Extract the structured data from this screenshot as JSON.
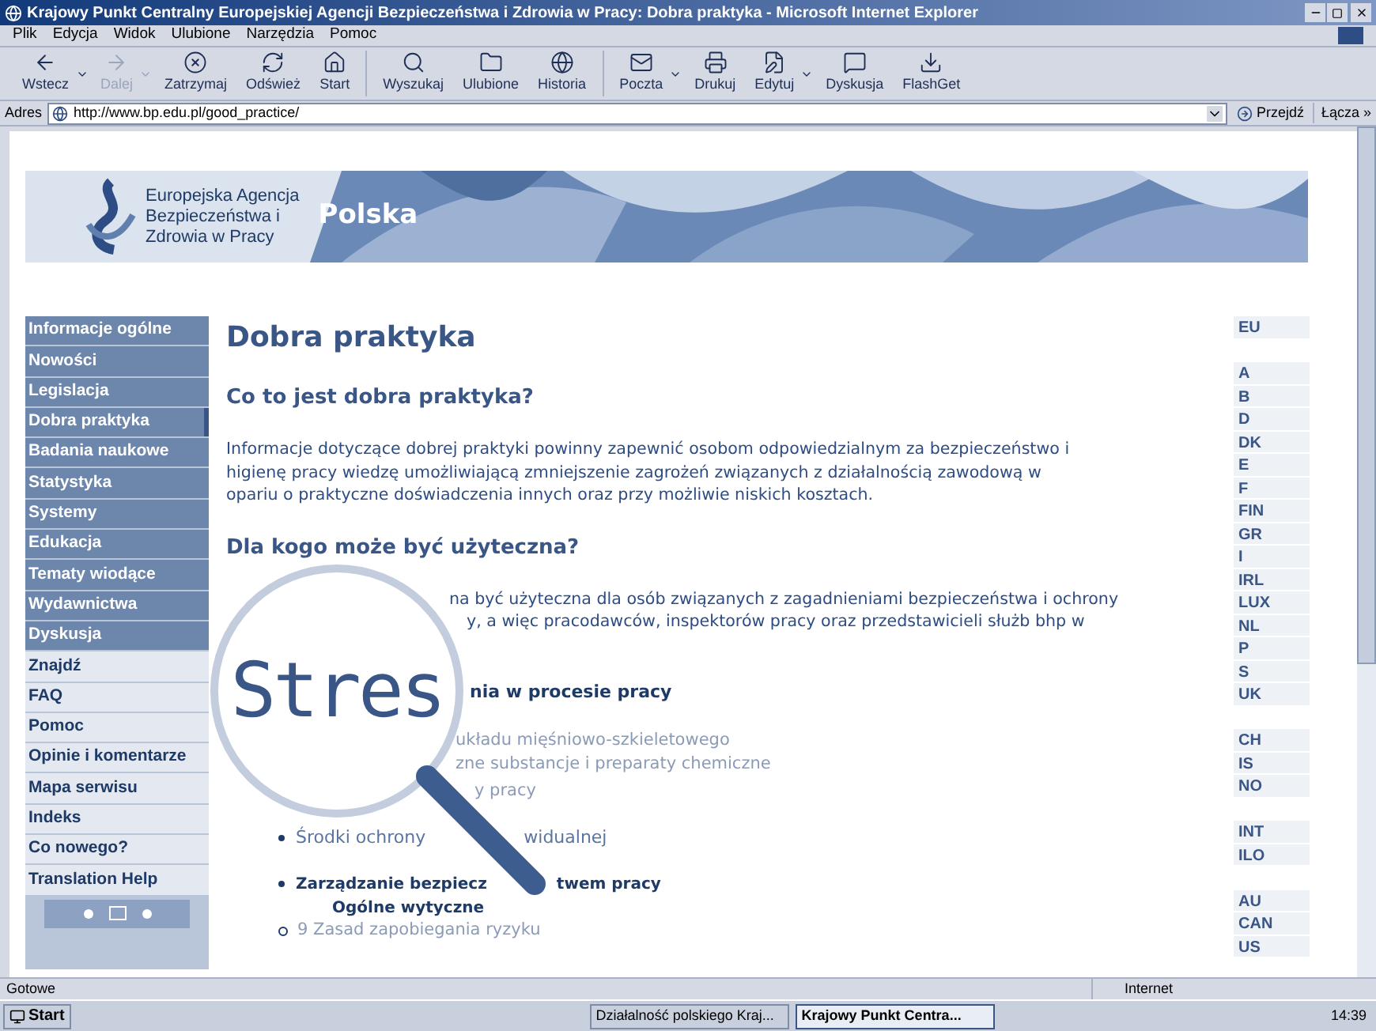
{
  "window": {
    "title": "Krajowy Punkt Centralny Europejskiej Agencji Bezpieczeństwa i Zdrowia w Pracy: Dobra praktyka - Microsoft Internet Explorer"
  },
  "menu": [
    "Plik",
    "Edycja",
    "Widok",
    "Ulubione",
    "Narzędzia",
    "Pomoc"
  ],
  "toolbar": [
    [
      {
        "label": "Wstecz",
        "disabled": false,
        "dropdown": true
      },
      {
        "label": "Dalej",
        "disabled": true,
        "dropdown": true
      },
      {
        "label": "Zatrzymaj",
        "disabled": false,
        "dropdown": false
      },
      {
        "label": "Odśwież",
        "disabled": false,
        "dropdown": false
      },
      {
        "label": "Start",
        "disabled": false,
        "dropdown": false
      }
    ],
    [
      {
        "label": "Wyszukaj",
        "disabled": false,
        "dropdown": false
      },
      {
        "label": "Ulubione",
        "disabled": false,
        "dropdown": false
      },
      {
        "label": "Historia",
        "disabled": false,
        "dropdown": false
      }
    ],
    [
      {
        "label": "Poczta",
        "disabled": false,
        "dropdown": true
      },
      {
        "label": "Drukuj",
        "disabled": false,
        "dropdown": false
      },
      {
        "label": "Edytuj",
        "disabled": false,
        "dropdown": true
      },
      {
        "label": "Dyskusja",
        "disabled": false,
        "dropdown": false
      },
      {
        "label": "FlashGet",
        "disabled": false,
        "dropdown": false
      }
    ]
  ],
  "address": {
    "label": "Adres",
    "value": "http://www.bp.edu.pl/good_practice/",
    "go": "Przejdź",
    "links": "Łącza »"
  },
  "banner": {
    "org_lines": [
      "Europejska Agencja",
      "Bezpieczeństwa i",
      "Zdrowia w Pracy"
    ],
    "country": "Polska"
  },
  "sidebar": [
    {
      "label": "Informacje ogólne",
      "kind": "primary",
      "selected": false
    },
    {
      "label": "Nowości",
      "kind": "primary",
      "selected": false
    },
    {
      "label": "Legislacja",
      "kind": "primary",
      "selected": false
    },
    {
      "label": "Dobra praktyka",
      "kind": "primary",
      "selected": true
    },
    {
      "label": "Badania naukowe",
      "kind": "primary",
      "selected": false
    },
    {
      "label": "Statystyka",
      "kind": "primary",
      "selected": false
    },
    {
      "label": "Systemy",
      "kind": "primary",
      "selected": false
    },
    {
      "label": "Edukacja",
      "kind": "primary",
      "selected": false
    },
    {
      "label": "Tematy wiodące",
      "kind": "primary",
      "selected": false
    },
    {
      "label": "Wydawnictwa",
      "kind": "primary",
      "selected": false
    },
    {
      "label": "Dyskusja",
      "kind": "primary",
      "selected": false
    },
    {
      "label": "Znajdź",
      "kind": "secondary",
      "selected": false
    },
    {
      "label": "FAQ",
      "kind": "secondary",
      "selected": false
    },
    {
      "label": "Pomoc",
      "kind": "secondary",
      "selected": false
    },
    {
      "label": "Opinie i komentarze",
      "kind": "secondary",
      "selected": false
    },
    {
      "label": "Mapa serwisu",
      "kind": "secondary",
      "selected": false
    },
    {
      "label": "Indeks",
      "kind": "secondary",
      "selected": false
    },
    {
      "label": "Co nowego?",
      "kind": "secondary",
      "selected": false
    },
    {
      "label": "Translation Help",
      "kind": "secondary",
      "selected": false
    }
  ],
  "content": {
    "title": "Dobra praktyka",
    "heading_1": "Co to jest dobra praktyka?",
    "paragraph_1": [
      "Informacje dotyczące dobrej praktyki powinny zapewnić osobom odpowiedzialnym za bezpieczeństwo i",
      "higienę pracy wiedzę umożliwiającą zmniejszenie zagrożeń związanych z działalnością zawodową w",
      "opariu o praktyczne doświadczenia innych oraz przy możliwie niskich kosztach."
    ],
    "heading_2": "Dla kogo może być użyteczna?",
    "paragraph_2": [
      "na być użyteczna dla osób związanych z zagadnieniami bezpieczeństwa i ochrony",
      "y, a więc pracodawców, inspektorów pracy oraz przedstawicieli służb bhp w"
    ],
    "topics": [
      {
        "kind": "heading",
        "parts": [
          "nia w procesie pracy"
        ]
      },
      {
        "kind": "link",
        "parts": [
          "układu mięśniowo-szkieletowego"
        ]
      },
      {
        "kind": "link",
        "parts": [
          "zne substancje i preparaty chemiczne"
        ]
      },
      {
        "kind": "link",
        "parts": [
          "y pracy"
        ]
      },
      {
        "kind": "bullet",
        "parts": [
          "Środki ochrony",
          "widualnej"
        ]
      },
      {
        "kind": "bullet_heading",
        "parts": [
          "Zarządzanie bezpiecz",
          "twem pracy"
        ]
      },
      {
        "kind": "subheading",
        "parts": [
          "Ogólne wytyczne"
        ]
      },
      {
        "kind": "subitem",
        "parts": [
          "9 Zasad zapobiegania ryzyku"
        ]
      }
    ]
  },
  "magnifier": {
    "text": "Stres"
  },
  "countries": [
    [
      "EU"
    ],
    [
      "A",
      "B",
      "D",
      "DK",
      "E",
      "F",
      "FIN",
      "GR",
      "I",
      "IRL",
      "LUX",
      "NL",
      "P",
      "S",
      "UK"
    ],
    [
      "CH",
      "IS",
      "NO"
    ],
    [
      "INT",
      "ILO"
    ],
    [
      "AU",
      "CAN",
      "US"
    ]
  ],
  "status": {
    "text": "Gotowe",
    "zone": "Internet"
  },
  "taskbar": {
    "start": "Start",
    "tasks": [
      {
        "label": "Działalność polskiego Kraj...",
        "selected": false
      },
      {
        "label": "Krajowy Punkt Centra...",
        "selected": true
      }
    ],
    "clock": "14:39"
  }
}
